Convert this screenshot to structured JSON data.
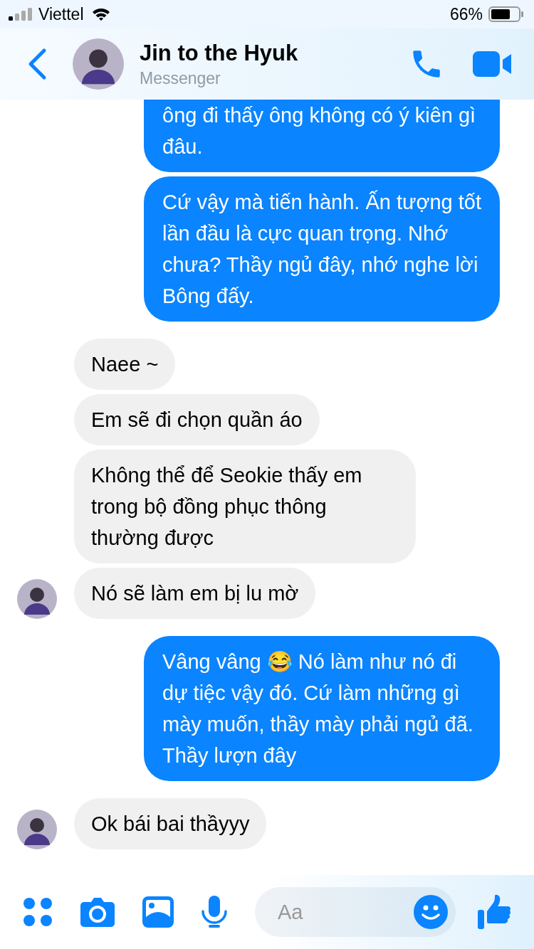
{
  "status_bar": {
    "carrier": "Viettel",
    "battery": "66%"
  },
  "header": {
    "title": "Jin to the Hyuk",
    "subtitle": "Messenger"
  },
  "messages": [
    {
      "kind": "outgoing",
      "text": "ông đi thấy ông không có ý kiên gì đâu.",
      "cut_top": true
    },
    {
      "kind": "outgoing",
      "text": "Cứ vậy mà tiến hành. Ấn tượng tốt lần đầu là cực quan trọng. Nhớ chưa? Thầy ngủ đây, nhớ nghe lời Bông đấy.",
      "cut_top": false
    },
    {
      "kind": "incoming",
      "text": "Naee ~",
      "show_avatar": false,
      "cut_top": false
    },
    {
      "kind": "incoming",
      "text": "Em sẽ đi chọn quần áo",
      "show_avatar": false,
      "cut_top": false
    },
    {
      "kind": "incoming",
      "text": "Không thể để Seokie thấy em trong bộ đồng phục thông thường được",
      "show_avatar": false,
      "cut_top": false
    },
    {
      "kind": "incoming",
      "text": "Nó sẽ làm em bị lu mờ",
      "show_avatar": true,
      "cut_top": false
    },
    {
      "kind": "outgoing",
      "text": "Vâng vâng 😂 Nó làm như nó đi dự tiệc vậy đó. Cứ làm những gì mày muốn, thầy mày phải ngủ đã. Thầy lượn đây",
      "cut_top": false
    },
    {
      "kind": "incoming",
      "text": "Ok bái bai thầyyy",
      "show_avatar": true,
      "cut_top": false
    }
  ],
  "composer": {
    "placeholder": "Aa"
  }
}
